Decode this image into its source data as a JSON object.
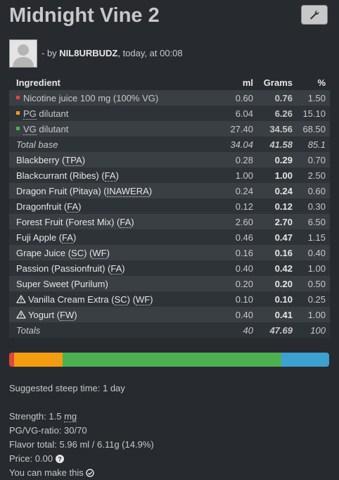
{
  "header": {
    "title": "Midnight Vine 2",
    "by_prefix": "- by",
    "author": "NIL8URBUDZ",
    "when": ", today, at 00:08"
  },
  "table": {
    "columns": [
      "Ingredient",
      "ml",
      "Grams",
      "%"
    ],
    "base": [
      {
        "name": "Nicotine juice 100 mg (100% VG)",
        "ml": "0.60",
        "grams": "0.76",
        "pct": "1.50",
        "color": "#e0453a"
      },
      {
        "name_abbr": "PG",
        "name_rest": " dilutant",
        "ml": "6.04",
        "grams": "6.26",
        "pct": "15.10",
        "color": "#f39c12"
      },
      {
        "name_abbr": "VG",
        "name_rest": " dilutant",
        "ml": "27.40",
        "grams": "34.56",
        "pct": "68.50",
        "color": "#4caf50"
      }
    ],
    "total_base": {
      "label": "Total base",
      "ml": "34.04",
      "grams": "41.58",
      "pct": "85.1"
    },
    "flavors": [
      {
        "parts": [
          "Blackberry (",
          "TPA",
          ")"
        ],
        "ml": "0.28",
        "grams": "0.29",
        "pct": "0.70"
      },
      {
        "parts": [
          "Blackcurrant (Ribes) (",
          "FA",
          ")"
        ],
        "ml": "1.00",
        "grams": "1.00",
        "pct": "2.50"
      },
      {
        "parts": [
          "Dragon Fruit (Pitaya) (",
          "INAWERA",
          ")"
        ],
        "ml": "0.24",
        "grams": "0.24",
        "pct": "0.60"
      },
      {
        "parts": [
          "Dragonfruit (",
          "FA",
          ")"
        ],
        "ml": "0.12",
        "grams": "0.12",
        "pct": "0.30"
      },
      {
        "parts": [
          "Forest Fruit (Forest Mix) (",
          "FA",
          ")"
        ],
        "ml": "2.60",
        "grams": "2.70",
        "pct": "6.50"
      },
      {
        "parts": [
          "Fuji Apple (",
          "FA",
          ")"
        ],
        "ml": "0.46",
        "grams": "0.47",
        "pct": "1.15"
      },
      {
        "parts": [
          "Grape Juice (",
          "SC",
          ") (",
          "WF",
          ")"
        ],
        "ml": "0.16",
        "grams": "0.16",
        "pct": "0.40"
      },
      {
        "parts": [
          "Passion (Passionfruit) (",
          "FA",
          ")"
        ],
        "ml": "0.40",
        "grams": "0.42",
        "pct": "1.00"
      },
      {
        "parts": [
          "Super Sweet (Purilum)"
        ],
        "ml": "0.20",
        "grams": "0.20",
        "pct": "0.50"
      },
      {
        "parts": [
          "Vanilla Cream Extra (",
          "SC",
          ") (",
          "WF",
          ")"
        ],
        "ml": "0.10",
        "grams": "0.10",
        "pct": "0.25",
        "warning": true
      },
      {
        "parts": [
          "Yogurt (",
          "FW",
          ")"
        ],
        "ml": "0.40",
        "grams": "0.41",
        "pct": "1.00",
        "warning": true
      }
    ],
    "totals": {
      "label": "Totals",
      "ml": "40",
      "grams": "47.69",
      "pct": "100"
    }
  },
  "bar_segments": [
    {
      "name": "nicotine",
      "pct": 1.5,
      "color": "#e0453a"
    },
    {
      "name": "pg",
      "pct": 15.1,
      "color": "#f39c12"
    },
    {
      "name": "vg",
      "pct": 68.5,
      "color": "#4caf50"
    },
    {
      "name": "flavor",
      "pct": 14.9,
      "color": "#3ca0d0"
    }
  ],
  "info": {
    "steep": "Suggested steep time: 1 day",
    "strength_prefix": "Strength: 1.5 ",
    "strength_unit": "mg",
    "pgvg": "PG/VG-ratio: 30/70",
    "flavor_total": "Flavor total: 5.96 ml / 6.11g (14.9%)",
    "price": "Price: 0.00",
    "can_make": "You can make this"
  },
  "icons": {
    "wrench": "wrench-icon",
    "warning": "warning-icon",
    "help": "help-icon",
    "check": "check-circle-icon",
    "avatar": "avatar-placeholder"
  }
}
